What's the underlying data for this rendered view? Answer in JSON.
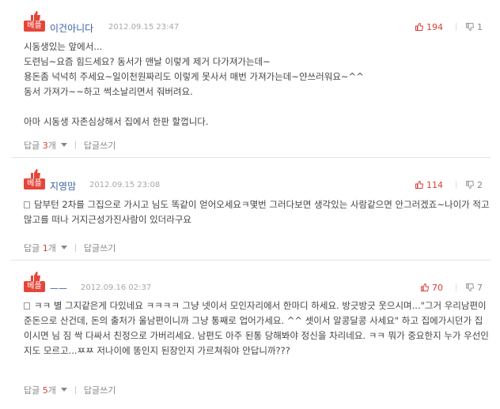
{
  "best_label": "베플",
  "reply_label": "답글",
  "reply_count_unit": "개",
  "write_reply_label": "답글쓰기",
  "comments": [
    {
      "author": "이건아니다",
      "date": "2012.09.15 23:47",
      "up": "194",
      "down": "1",
      "body": "시동생있는 앞에서...\n도련님~요즘 힘드세요? 동서가 맨날 이렇게 제거 다가져가는데~\n용돈좀 넉넉히 주세요~일이천원짜리도 이렇게 못사서 매번 가져가는데~얀쓰러워요~^^\n동서 가져가~~하고 썩소날리면서 줘버려요.\n\n아마 시동생 자존심상해서 집에서 한판 할껍니다.",
      "replies": "3"
    },
    {
      "author": "지영맘",
      "date": "2012.09.15 23:08",
      "up": "114",
      "down": "2",
      "body": "담부턴 2차를 그집으로 가시고 님도 똑같이 얻어오세요ㅋ몇번 그러다보면 생각있는 사람같으면 안그러겠죠~나이가 적고 많고를 떠나 거지근성가진사람이 있더라구요",
      "replies": "1"
    },
    {
      "author": "ㅡㅡ",
      "date": "2012.09.16 02:37",
      "up": "70",
      "down": "7",
      "body": "ㅋㅋ 별 그지같은게 다있네요 ㅋㅋㅋㅋ 그냥 넷이서 모인자리에서 한마디 하세요. 방긋방긋 웃으시며...\"그거 우리남편이 준돈으로 산건데, 돈의 출처가 울남편이니까 그냥 통째로 업어가세요. ^^ 셋이서 알콩달콩 사세요\" 하고 집에가시던가 집이시면 님 짐 싹 다싸서 친정으로 가버리세요. 남편도 아주 된통 당해봐야 정신을 차리네요. ㅋㅋ 뭐가 중요한지 누가 우선인지도 모르고...ㅉㅉ 저나이에 똥인지 된장인지 가르쳐줘야 안답니까???",
      "replies": "5"
    }
  ]
}
